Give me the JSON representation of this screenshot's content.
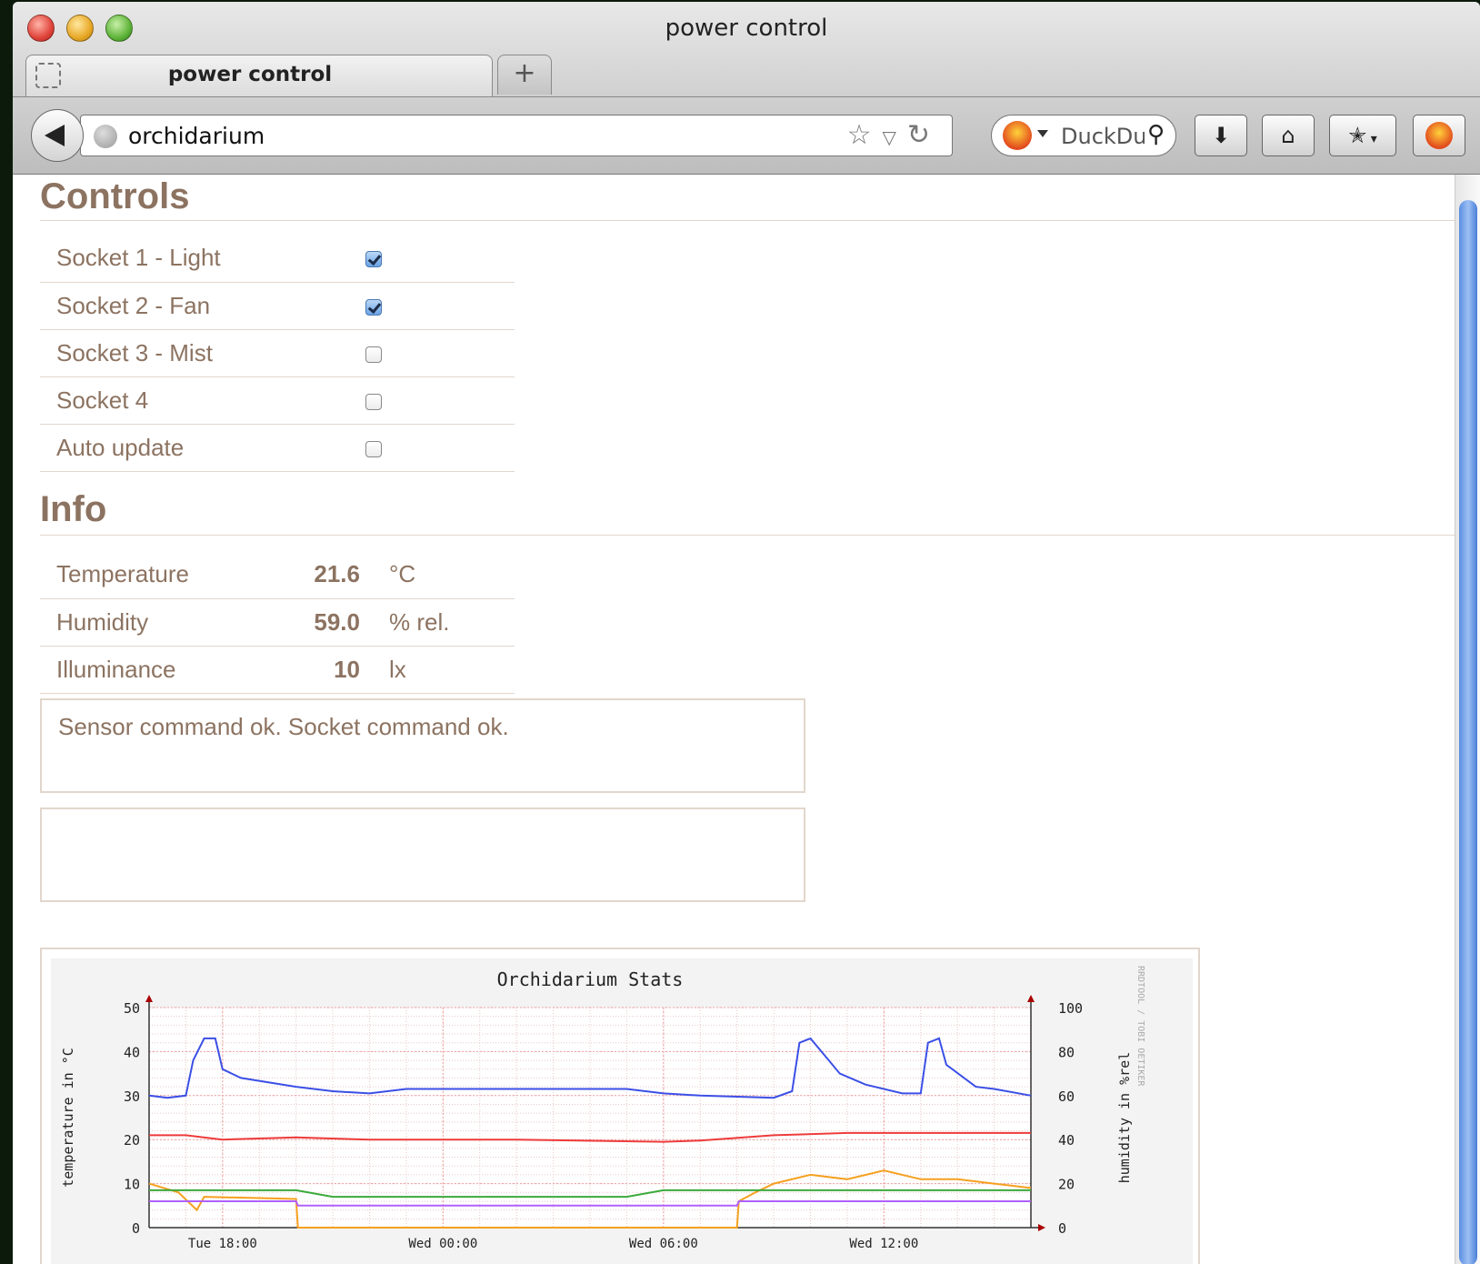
{
  "browser": {
    "window_title": "power control",
    "tab_title": "power control",
    "new_tab_label": "+",
    "url": "orchidarium",
    "search_placeholder": "DuckDuckGo"
  },
  "controls": {
    "heading": "Controls",
    "items": [
      {
        "label": "Socket 1 - Light",
        "checked": true
      },
      {
        "label": "Socket 2 - Fan",
        "checked": true
      },
      {
        "label": "Socket 3 - Mist",
        "checked": false
      },
      {
        "label": "Socket 4",
        "checked": false
      },
      {
        "label": "Auto update",
        "checked": false
      }
    ]
  },
  "info": {
    "heading": "Info",
    "rows": [
      {
        "label": "Temperature",
        "value": "21.6",
        "unit": "°C"
      },
      {
        "label": "Humidity",
        "value": "59.0",
        "unit": "% rel."
      },
      {
        "label": "Illuminance",
        "value": "10",
        "unit": "lx"
      }
    ]
  },
  "messages": {
    "status": "Sensor command ok. Socket command ok.",
    "second": ""
  },
  "chart_data": {
    "type": "line",
    "title": "Orchidarium Stats",
    "ylabel_left": "temperature in °C",
    "ylabel_right": "humidity in %rel",
    "watermark": "RRDTOOL / TOBI OETIKER",
    "y_left_ticks": [
      0,
      10,
      20,
      30,
      40,
      50
    ],
    "y_right_ticks": [
      0,
      20,
      40,
      60,
      80,
      100
    ],
    "x_ticks": [
      "Tue 18:00",
      "Wed 00:00",
      "Wed 06:00",
      "Wed 12:00"
    ],
    "x_range_hours": [
      0,
      24
    ],
    "ylim_left": [
      0,
      50
    ],
    "ylim_right": [
      0,
      100
    ],
    "grid": true,
    "colors": {
      "humidity": "#3b4fe6",
      "temperature": "#ee3b3b",
      "illuminance": "#f5a020",
      "green": "#3caa3c",
      "purple": "#b060ff"
    },
    "series": [
      {
        "id": "humidity",
        "axis": "right",
        "points": [
          [
            0,
            60
          ],
          [
            0.5,
            59
          ],
          [
            1,
            60
          ],
          [
            1.2,
            76
          ],
          [
            1.5,
            86
          ],
          [
            1.8,
            86
          ],
          [
            2.0,
            72
          ],
          [
            2.5,
            68
          ],
          [
            4,
            64
          ],
          [
            5,
            62
          ],
          [
            6,
            61
          ],
          [
            7,
            63
          ],
          [
            10,
            63
          ],
          [
            13,
            63
          ],
          [
            14,
            61
          ],
          [
            15,
            60
          ],
          [
            17,
            59
          ],
          [
            17.5,
            62
          ],
          [
            17.7,
            84
          ],
          [
            18,
            86
          ],
          [
            18.3,
            80
          ],
          [
            18.8,
            70
          ],
          [
            19.5,
            65
          ],
          [
            20.5,
            61
          ],
          [
            21,
            61
          ],
          [
            21.2,
            84
          ],
          [
            21.5,
            86
          ],
          [
            21.7,
            74
          ],
          [
            22.5,
            64
          ],
          [
            23,
            63
          ],
          [
            24,
            60
          ]
        ]
      },
      {
        "id": "temperature",
        "axis": "left",
        "points": [
          [
            0,
            21
          ],
          [
            1,
            21
          ],
          [
            2,
            20
          ],
          [
            4,
            20.5
          ],
          [
            6,
            20
          ],
          [
            10,
            20
          ],
          [
            14,
            19.5
          ],
          [
            15,
            19.8
          ],
          [
            17,
            21
          ],
          [
            19,
            21.5
          ],
          [
            22,
            21.5
          ],
          [
            24,
            21.5
          ]
        ]
      },
      {
        "id": "illuminance",
        "axis": "left",
        "points": [
          [
            0,
            10
          ],
          [
            0.8,
            8
          ],
          [
            1.3,
            4
          ],
          [
            1.5,
            7
          ],
          [
            4,
            6.5
          ],
          [
            4.05,
            0
          ],
          [
            16,
            0
          ],
          [
            16.05,
            6
          ],
          [
            16.5,
            8
          ],
          [
            17,
            10
          ],
          [
            18,
            12
          ],
          [
            19,
            11
          ],
          [
            20,
            13
          ],
          [
            21,
            11
          ],
          [
            22,
            11
          ],
          [
            23,
            10
          ],
          [
            24,
            9
          ]
        ]
      },
      {
        "id": "green",
        "axis": "left",
        "points": [
          [
            0,
            8.5
          ],
          [
            1,
            8.5
          ],
          [
            1.5,
            8.5
          ],
          [
            4,
            8.5
          ],
          [
            5,
            7
          ],
          [
            13,
            7
          ],
          [
            14,
            8.5
          ],
          [
            18,
            8.5
          ],
          [
            21,
            8.5
          ],
          [
            22,
            8.5
          ],
          [
            24,
            8.5
          ]
        ]
      },
      {
        "id": "purple",
        "axis": "left",
        "points": [
          [
            0,
            6
          ],
          [
            4,
            6
          ],
          [
            4.05,
            5
          ],
          [
            16,
            5
          ],
          [
            16.05,
            6
          ],
          [
            24,
            6
          ]
        ]
      }
    ]
  }
}
